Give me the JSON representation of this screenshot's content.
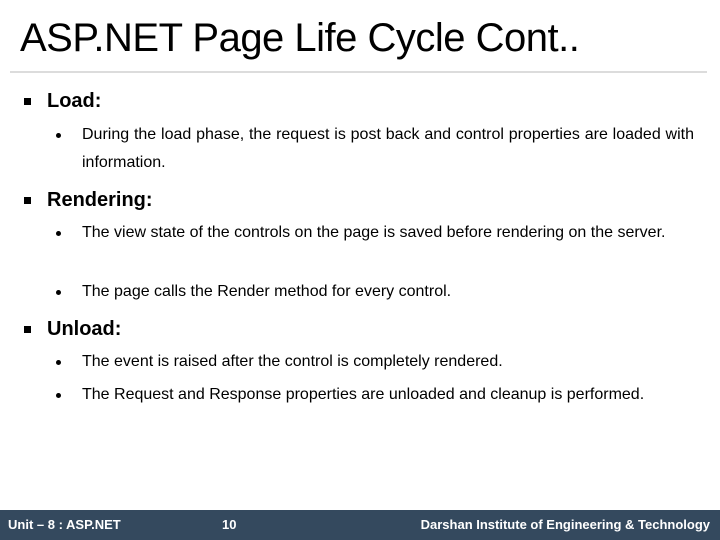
{
  "slide": {
    "title": "ASP.NET Page Life Cycle Cont..",
    "sections": [
      {
        "heading": "Load:",
        "items": [
          "During the load phase, the request is post back and control properties are loaded with information."
        ]
      },
      {
        "heading": "Rendering:",
        "items": [
          "The view state of the controls on the page is saved before rendering on the server.",
          "The page calls the Render method for every control."
        ]
      },
      {
        "heading": "Unload:",
        "items": [
          "The event is raised after the control is completely rendered.",
          "The Request and Response properties are unloaded and cleanup is performed."
        ]
      }
    ]
  },
  "footer": {
    "unit": "Unit – 8 : ASP.NET",
    "page_number": "10",
    "institute": "Darshan Institute of Engineering & Technology"
  },
  "colors": {
    "footer_background": "#34495e",
    "footer_text": "#ffffff",
    "title_rule": "#dcdcdc"
  }
}
